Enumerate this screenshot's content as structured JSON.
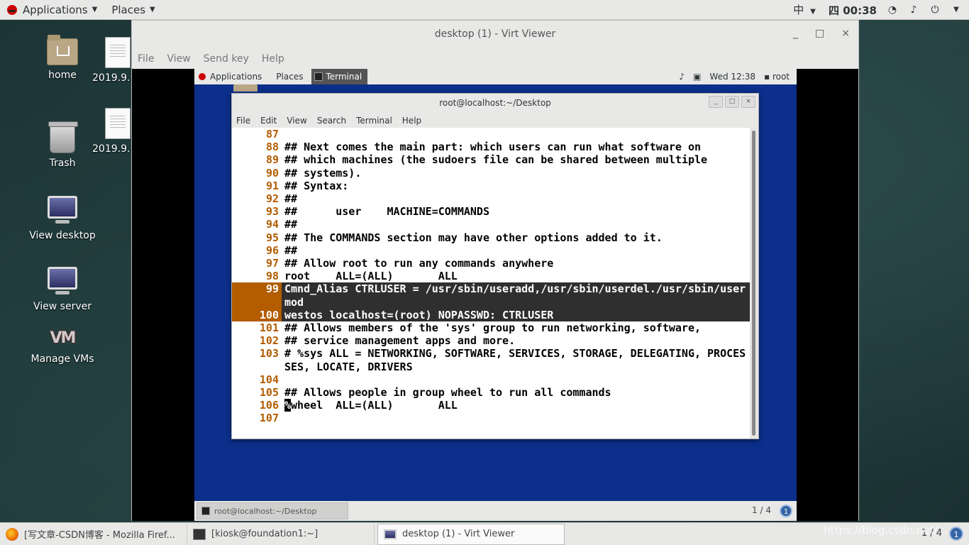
{
  "host": {
    "topbar": {
      "applications": "Applications",
      "places": "Places",
      "input_method": "中",
      "clock": "四 00:38"
    },
    "desktop_icons": [
      {
        "label": "home"
      },
      {
        "label": "2019.9."
      },
      {
        "label": "Trash"
      },
      {
        "label": "2019.9."
      },
      {
        "label": "View desktop"
      },
      {
        "label": "View server"
      },
      {
        "label": "Manage VMs"
      }
    ],
    "taskbar": {
      "tasks": [
        {
          "label": "[写文章-CSDN博客 - Mozilla Firef..."
        },
        {
          "label": "[kiosk@foundation1:~]"
        },
        {
          "label": "desktop (1) - Virt Viewer"
        }
      ],
      "pager": "1 / 4",
      "badge": "1"
    },
    "watermark": "https://blog.csdn.net/..."
  },
  "virt_viewer": {
    "title": "desktop (1) - Virt Viewer",
    "controls": {
      "minimize": "_",
      "maximize": "□",
      "close": "×"
    },
    "menu": [
      "File",
      "View",
      "Send key",
      "Help"
    ]
  },
  "guest": {
    "topbar": {
      "applications": "Applications",
      "places": "Places",
      "active_task": "Terminal",
      "clock": "Wed 12:38",
      "user": "root"
    },
    "terminal": {
      "title": "root@localhost:~/Desktop",
      "menu": [
        "File",
        "Edit",
        "View",
        "Search",
        "Terminal",
        "Help"
      ],
      "lines": [
        {
          "num": "87",
          "text": ""
        },
        {
          "num": "88",
          "text": "## Next comes the main part: which users can run what software on"
        },
        {
          "num": "89",
          "text": "## which machines (the sudoers file can be shared between multiple"
        },
        {
          "num": "90",
          "text": "## systems)."
        },
        {
          "num": "91",
          "text": "## Syntax:"
        },
        {
          "num": "92",
          "text": "##"
        },
        {
          "num": "93",
          "text": "##      user    MACHINE=COMMANDS"
        },
        {
          "num": "94",
          "text": "##"
        },
        {
          "num": "95",
          "text": "## The COMMANDS section may have other options added to it."
        },
        {
          "num": "96",
          "text": "##"
        },
        {
          "num": "97",
          "text": "## Allow root to run any commands anywhere"
        },
        {
          "num": "98",
          "text": "root    ALL=(ALL)       ALL"
        },
        {
          "num": "99",
          "text": "Cmnd_Alias CTRLUSER = /usr/sbin/useradd,/usr/sbin/userdel./usr/sbin/user"
        },
        {
          "num": "",
          "text": "mod"
        },
        {
          "num": "100",
          "text": "westos localhost=(root) NOPASSWD: CTRLUSER"
        },
        {
          "num": "101",
          "text": "## Allows members of the 'sys' group to run networking, software,"
        },
        {
          "num": "102",
          "text": "## service management apps and more."
        },
        {
          "num": "103",
          "text": "# %sys ALL = NETWORKING, SOFTWARE, SERVICES, STORAGE, DELEGATING, PROCES"
        },
        {
          "num": "",
          "text": "SES, LOCATE, DRIVERS"
        },
        {
          "num": "104",
          "text": ""
        },
        {
          "num": "105",
          "text": "## Allows people in group wheel to run all commands"
        },
        {
          "num": "106",
          "text": "wheel  ALL=(ALL)       ALL",
          "cursor_char": "%"
        },
        {
          "num": "107",
          "text": ""
        }
      ]
    },
    "bottom": {
      "task": "root@localhost:~/Desktop",
      "pager": "1 / 4",
      "badge": "1"
    }
  }
}
